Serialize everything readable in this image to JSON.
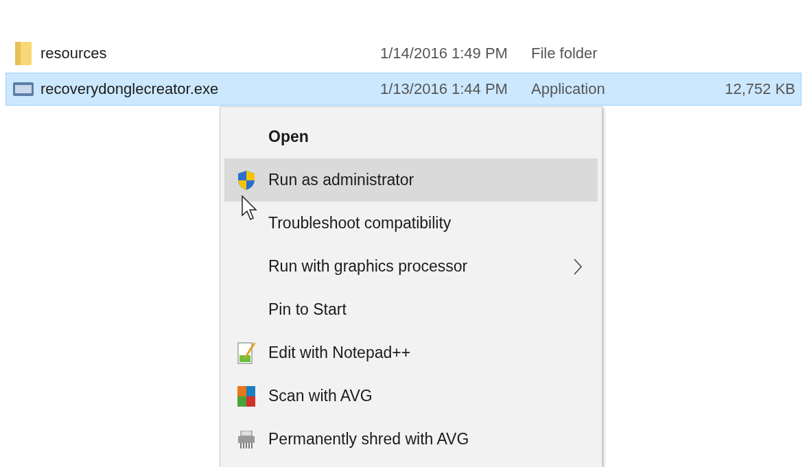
{
  "files": [
    {
      "name": "resources",
      "date": "1/14/2016 1:49 PM",
      "type": "File folder",
      "kind": "folder",
      "selected": false
    },
    {
      "name": "recoverydonglecreator.exe",
      "date": "1/13/2016 1:44 PM",
      "type": "Application",
      "size": "12,752 KB",
      "kind": "app",
      "selected": true
    }
  ],
  "context_menu": {
    "items": [
      {
        "label": "Open",
        "bold": true,
        "selected": false
      },
      {
        "label": "Run as administrator",
        "kind": "shield",
        "selected": true
      },
      {
        "label": "Troubleshoot compatibility",
        "selected": false
      },
      {
        "label": "Run with graphics processor",
        "submenu": true,
        "selected": false
      },
      {
        "label": "Pin to Start",
        "selected": false
      },
      {
        "label": "Edit with Notepad++",
        "kind": "notepad",
        "selected": false
      },
      {
        "label": "Scan with AVG",
        "kind": "avg",
        "selected": false
      },
      {
        "label": "Permanently shred with AVG",
        "kind": "shredder",
        "selected": false
      }
    ]
  }
}
